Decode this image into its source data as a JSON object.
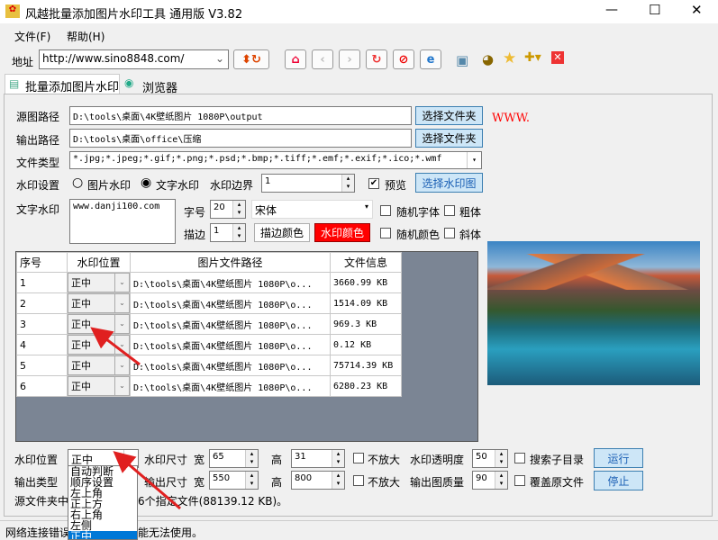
{
  "window": {
    "title": "风越批量添加图片水印工具 通用版 V3.82",
    "controls": [
      "—",
      "☐",
      "✕"
    ]
  },
  "menu": [
    "文件(F)",
    "帮助(H)"
  ],
  "toolbar": {
    "address_label": "地址",
    "address_value": "http://www.sino8848.com/"
  },
  "tabs": [
    "批量添加图片水印",
    "浏览器"
  ],
  "form": {
    "source_label": "源图路径",
    "source_value": "D:\\tools\\桌面\\4K壁纸图片 1080P\\output",
    "choose_folder": "选择文件夹",
    "output_label": "输出路径",
    "output_value": "D:\\tools\\桌面\\office\\压缩",
    "filetype_label": "文件类型",
    "filetype_value": "*.jpg;*.jpeg;*.gif;*.png;*.psd;*.bmp;*.tiff;*.emf;*.exif;*.ico;*.wmf",
    "wm_settings_label": "水印设置",
    "image_wm": "图片水印",
    "text_wm": "文字水印",
    "border_label": "水印边界",
    "border_value": "1",
    "preview": "预览",
    "choose_wm_image": "选择水印图",
    "text_wm_label": "文字水印",
    "text_wm_value": "www.danji100.com",
    "font_size_label": "字号",
    "font_size_value": "20",
    "font_value": "宋体",
    "random_font": "随机字体",
    "bold": "粗体",
    "stroke_label": "描边",
    "stroke_value": "1",
    "stroke_color": "描边颜色",
    "wm_color": "水印颜色",
    "random_color": "随机颜色",
    "italic": "斜体",
    "preview_text": "WWW."
  },
  "table": {
    "headers": [
      "序号",
      "水印位置",
      "图片文件路径",
      "文件信息"
    ],
    "rows": [
      [
        "1",
        "正中",
        "D:\\tools\\桌面\\4K壁纸图片 1080P\\o...",
        "3660.99 KB"
      ],
      [
        "2",
        "正中",
        "D:\\tools\\桌面\\4K壁纸图片 1080P\\o...",
        "1514.09 KB"
      ],
      [
        "3",
        "正中",
        "D:\\tools\\桌面\\4K壁纸图片 1080P\\o...",
        "969.3 KB"
      ],
      [
        "4",
        "正中",
        "D:\\tools\\桌面\\4K壁纸图片 1080P\\o...",
        "0.12 KB"
      ],
      [
        "5",
        "正中",
        "D:\\tools\\桌面\\4K壁纸图片 1080P\\o...",
        "75714.39 KB"
      ],
      [
        "6",
        "正中",
        "D:\\tools\\桌面\\4K壁纸图片 1080P\\o...",
        "6280.23 KB"
      ]
    ]
  },
  "bottom": {
    "pos_label": "水印位置",
    "pos_value": "正中",
    "wm_size_label": "水印尺寸",
    "w": "宽",
    "h": "高",
    "wm_w": "65",
    "wm_h": "31",
    "no_enlarge": "不放大",
    "opacity_label": "水印透明度",
    "opacity_value": "50",
    "search_sub": "搜索子目录",
    "run": "运行",
    "out_type_label": "输出类型",
    "out_size_label": "输出尺寸",
    "out_w": "550",
    "out_h": "800",
    "quality_label": "输出图质量",
    "quality_value": "90",
    "overwrite": "覆盖原文件",
    "stop": "停止",
    "summary_left": "源文件夹中",
    "summary_right": "6个指定文件(88139.12 KB)。"
  },
  "dropdown_options": [
    "自动判断",
    "顺序设置",
    "左上角",
    "正上方",
    "右上角",
    "左侧",
    "正中"
  ],
  "status": {
    "left": "网络连接错误",
    "right": "能无法使用。"
  },
  "colors": {
    "accent_button": "#cde6f7",
    "wm_color": "#ff0000",
    "table_bg": "#7b8594",
    "arrow": "#e02020"
  }
}
